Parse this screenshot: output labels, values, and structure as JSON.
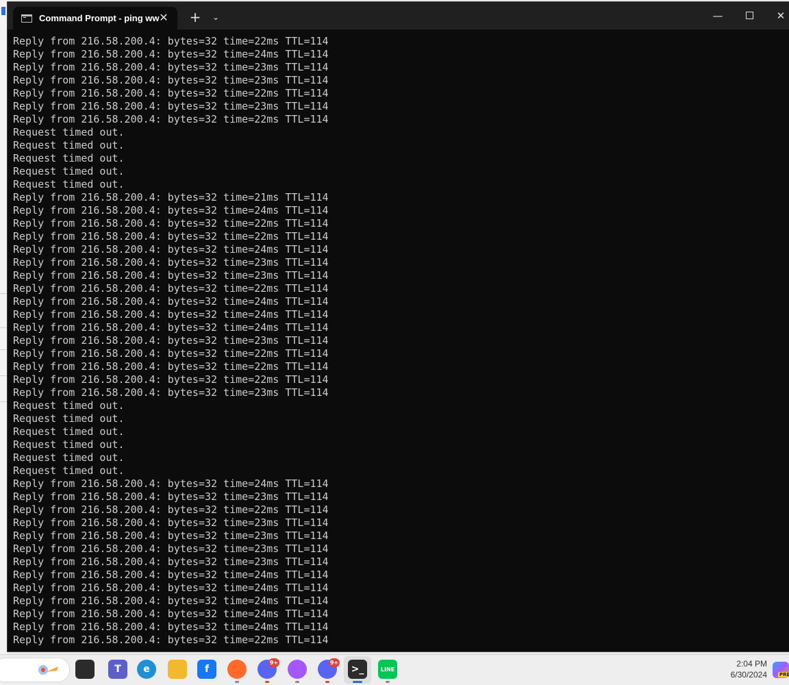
{
  "window": {
    "tab_title": "Command Prompt - ping  ww",
    "tab_close": "✕",
    "new_tab": "+",
    "dropdown": "⌄",
    "minimize": "—",
    "close": "✕"
  },
  "console": {
    "lines": [
      "Reply from 216.58.200.4: bytes=32 time=22ms TTL=114",
      "Reply from 216.58.200.4: bytes=32 time=24ms TTL=114",
      "Reply from 216.58.200.4: bytes=32 time=23ms TTL=114",
      "Reply from 216.58.200.4: bytes=32 time=23ms TTL=114",
      "Reply from 216.58.200.4: bytes=32 time=22ms TTL=114",
      "Reply from 216.58.200.4: bytes=32 time=23ms TTL=114",
      "Reply from 216.58.200.4: bytes=32 time=22ms TTL=114",
      "Request timed out.",
      "Request timed out.",
      "Request timed out.",
      "Request timed out.",
      "Request timed out.",
      "Reply from 216.58.200.4: bytes=32 time=21ms TTL=114",
      "Reply from 216.58.200.4: bytes=32 time=24ms TTL=114",
      "Reply from 216.58.200.4: bytes=32 time=22ms TTL=114",
      "Reply from 216.58.200.4: bytes=32 time=22ms TTL=114",
      "Reply from 216.58.200.4: bytes=32 time=24ms TTL=114",
      "Reply from 216.58.200.4: bytes=32 time=23ms TTL=114",
      "Reply from 216.58.200.4: bytes=32 time=23ms TTL=114",
      "Reply from 216.58.200.4: bytes=32 time=22ms TTL=114",
      "Reply from 216.58.200.4: bytes=32 time=24ms TTL=114",
      "Reply from 216.58.200.4: bytes=32 time=24ms TTL=114",
      "Reply from 216.58.200.4: bytes=32 time=24ms TTL=114",
      "Reply from 216.58.200.4: bytes=32 time=23ms TTL=114",
      "Reply from 216.58.200.4: bytes=32 time=22ms TTL=114",
      "Reply from 216.58.200.4: bytes=32 time=22ms TTL=114",
      "Reply from 216.58.200.4: bytes=32 time=22ms TTL=114",
      "Reply from 216.58.200.4: bytes=32 time=23ms TTL=114",
      "Request timed out.",
      "Request timed out.",
      "Request timed out.",
      "Request timed out.",
      "Request timed out.",
      "Request timed out.",
      "Reply from 216.58.200.4: bytes=32 time=24ms TTL=114",
      "Reply from 216.58.200.4: bytes=32 time=23ms TTL=114",
      "Reply from 216.58.200.4: bytes=32 time=22ms TTL=114",
      "Reply from 216.58.200.4: bytes=32 time=23ms TTL=114",
      "Reply from 216.58.200.4: bytes=32 time=23ms TTL=114",
      "Reply from 216.58.200.4: bytes=32 time=23ms TTL=114",
      "Reply from 216.58.200.4: bytes=32 time=23ms TTL=114",
      "Reply from 216.58.200.4: bytes=32 time=24ms TTL=114",
      "Reply from 216.58.200.4: bytes=32 time=24ms TTL=114",
      "Reply from 216.58.200.4: bytes=32 time=24ms TTL=114",
      "Reply from 216.58.200.4: bytes=32 time=24ms TTL=114",
      "Reply from 216.58.200.4: bytes=32 time=24ms TTL=114",
      "Reply from 216.58.200.4: bytes=32 time=22ms TTL=114"
    ]
  },
  "taskbar": {
    "time": "2:04 PM",
    "date": "6/30/2024",
    "copilot_badge": "PRE",
    "icons": [
      {
        "name": "task-view-icon",
        "glyph": "",
        "color": "#2b2b2b",
        "badge": "",
        "dot": ""
      },
      {
        "name": "teams-icon",
        "glyph": "T",
        "color": "#5b5fc7",
        "badge": "",
        "dot": ""
      },
      {
        "name": "edge-icon",
        "glyph": "e",
        "color": "#1f8fd6",
        "badge": "",
        "dot": ""
      },
      {
        "name": "file-explorer-icon",
        "glyph": "",
        "color": "#f2b92e",
        "badge": "",
        "dot": ""
      },
      {
        "name": "facebook-icon",
        "glyph": "f",
        "color": "#1877f2",
        "badge": "",
        "dot": ""
      },
      {
        "name": "firefox-icon",
        "glyph": "",
        "color": "#ff6a2b",
        "badge": "",
        "dot": "gray"
      },
      {
        "name": "discord-icon",
        "glyph": "",
        "color": "#5865f2",
        "badge": "9+",
        "dot": "red"
      },
      {
        "name": "messenger-icon",
        "glyph": "",
        "color": "#a557ff",
        "badge": "",
        "dot": "gray"
      },
      {
        "name": "discord-icon-2",
        "glyph": "",
        "color": "#5865f2",
        "badge": "9+",
        "dot": "red"
      },
      {
        "name": "terminal-icon",
        "glyph": ">_",
        "color": "#2b2b2b",
        "badge": "",
        "dot": "active"
      },
      {
        "name": "line-icon",
        "glyph": "LINE",
        "color": "#06c755",
        "badge": "",
        "dot": "gray"
      }
    ]
  }
}
